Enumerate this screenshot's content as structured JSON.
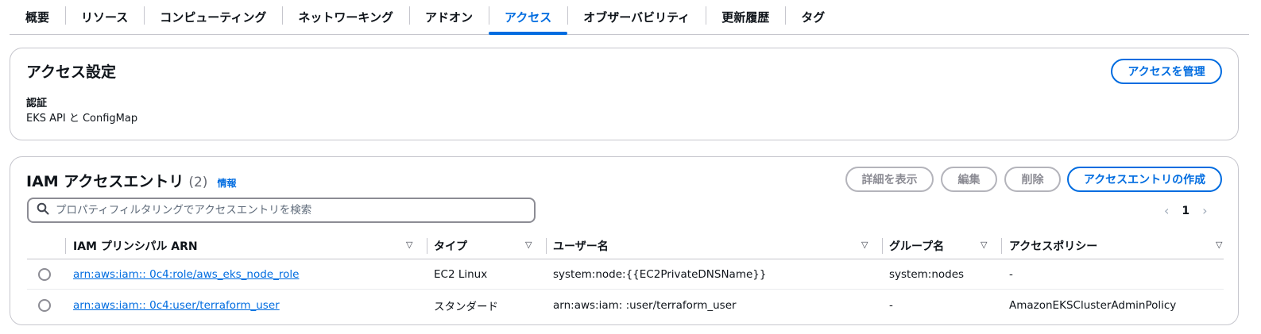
{
  "tabs": [
    {
      "label": "概要"
    },
    {
      "label": "リソース"
    },
    {
      "label": "コンピューティング"
    },
    {
      "label": "ネットワーキング"
    },
    {
      "label": "アドオン"
    },
    {
      "label": "アクセス",
      "active": true
    },
    {
      "label": "オブザーバビリティ"
    },
    {
      "label": "更新履歴"
    },
    {
      "label": "タグ"
    }
  ],
  "access_settings": {
    "title": "アクセス設定",
    "manage_button": "アクセスを管理",
    "auth_label": "認証",
    "auth_value": "EKS API と ConfigMap"
  },
  "entries": {
    "title": "IAM アクセスエントリ",
    "count": "(2)",
    "info_link": "情報",
    "buttons": {
      "details": "詳細を表示",
      "edit": "編集",
      "delete": "削除",
      "create": "アクセスエントリの作成"
    },
    "search_placeholder": "プロパティフィルタリングでアクセスエントリを検索",
    "pagination": {
      "prev": "‹",
      "page": "1",
      "next": "›"
    },
    "columns": [
      "IAM プリンシパル ARN",
      "タイプ",
      "ユーザー名",
      "グループ名",
      "アクセスポリシー"
    ],
    "rows": [
      {
        "arn": "arn:aws:iam::            0c4:role/aws_eks_node_role",
        "type": "EC2 Linux",
        "username": "system:node:{{EC2PrivateDNSName}}",
        "group": "system:nodes",
        "policy": "-"
      },
      {
        "arn": "arn:aws:iam::            0c4:user/terraform_user",
        "type": "スタンダード",
        "username": "arn:aws:iam:            :user/terraform_user",
        "group": "-",
        "policy": "AmazonEKSClusterAdminPolicy"
      }
    ]
  },
  "icons": {
    "search": "search-icon",
    "sort": "caret-down-icon",
    "prev": "chevron-left-icon",
    "next": "chevron-right-icon"
  },
  "colors": {
    "accent": "#006ce0",
    "border": "#c6c6cd",
    "disabled": "#8c8c94",
    "text": "#0f141a"
  }
}
